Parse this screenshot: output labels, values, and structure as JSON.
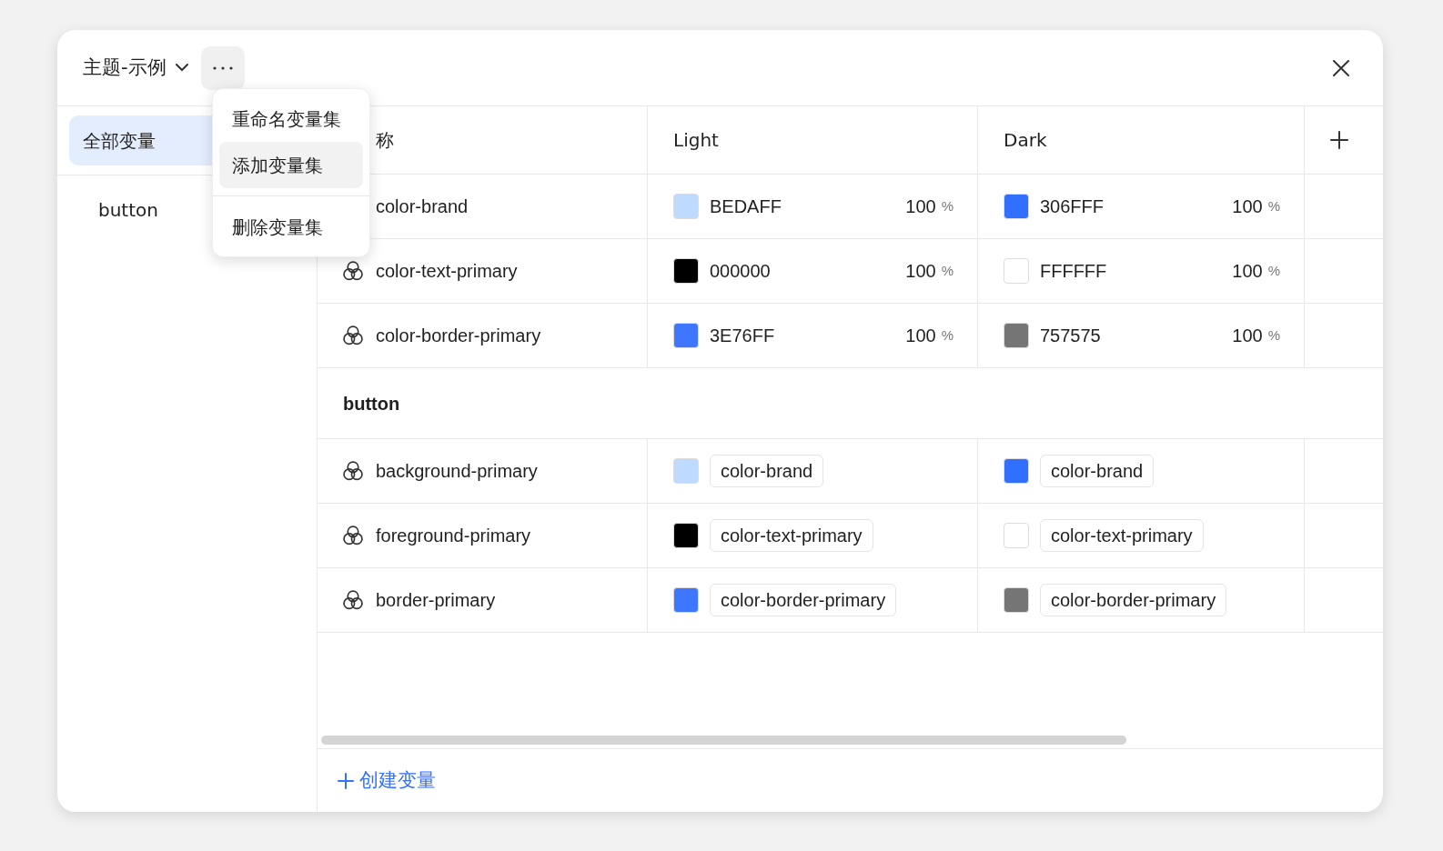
{
  "title": "主题-示例",
  "menu": [
    {
      "label": "重命名变量集",
      "selected": false
    },
    {
      "label": "添加变量集",
      "selected": true
    },
    {
      "label": "删除变量集",
      "selected": false
    }
  ],
  "sidebar": {
    "items": [
      {
        "label": "全部变量",
        "selected": true
      },
      {
        "label": "button",
        "selected": false
      }
    ]
  },
  "table": {
    "columns": [
      "称",
      "Light",
      "Dark"
    ],
    "groups": [
      {
        "rows": [
          {
            "name": "color-brand",
            "icon": false,
            "values": [
              {
                "kind": "hex",
                "color": "#bedaff",
                "text": "BEDAFF",
                "percent": "100",
                "unit": "%"
              },
              {
                "kind": "hex",
                "color": "#306fff",
                "text": "306FFF",
                "percent": "100",
                "unit": "%"
              }
            ]
          },
          {
            "name": "color-text-primary",
            "icon": true,
            "values": [
              {
                "kind": "hex",
                "color": "#000000",
                "text": "000000",
                "percent": "100",
                "unit": "%"
              },
              {
                "kind": "hex",
                "color": "#ffffff",
                "text": "FFFFFF",
                "percent": "100",
                "unit": "%"
              }
            ]
          },
          {
            "name": "color-border-primary",
            "icon": true,
            "values": [
              {
                "kind": "hex",
                "color": "#3e76ff",
                "text": "3E76FF",
                "percent": "100",
                "unit": "%"
              },
              {
                "kind": "hex",
                "color": "#757575",
                "text": "757575",
                "percent": "100",
                "unit": "%"
              }
            ]
          }
        ]
      },
      {
        "title": "button",
        "rows": [
          {
            "name": "background-primary",
            "icon": true,
            "values": [
              {
                "kind": "alias",
                "color": "#bedaff",
                "text": "color-brand"
              },
              {
                "kind": "alias",
                "color": "#306fff",
                "text": "color-brand"
              }
            ]
          },
          {
            "name": "foreground-primary",
            "icon": true,
            "values": [
              {
                "kind": "alias",
                "color": "#000000",
                "text": "color-text-primary"
              },
              {
                "kind": "alias",
                "color": "#ffffff",
                "text": "color-text-primary"
              }
            ]
          },
          {
            "name": "border-primary",
            "icon": true,
            "values": [
              {
                "kind": "alias",
                "color": "#3e76ff",
                "text": "color-border-primary"
              },
              {
                "kind": "alias",
                "color": "#757575",
                "text": "color-border-primary"
              }
            ]
          }
        ]
      }
    ]
  },
  "create_button": "创建变量"
}
